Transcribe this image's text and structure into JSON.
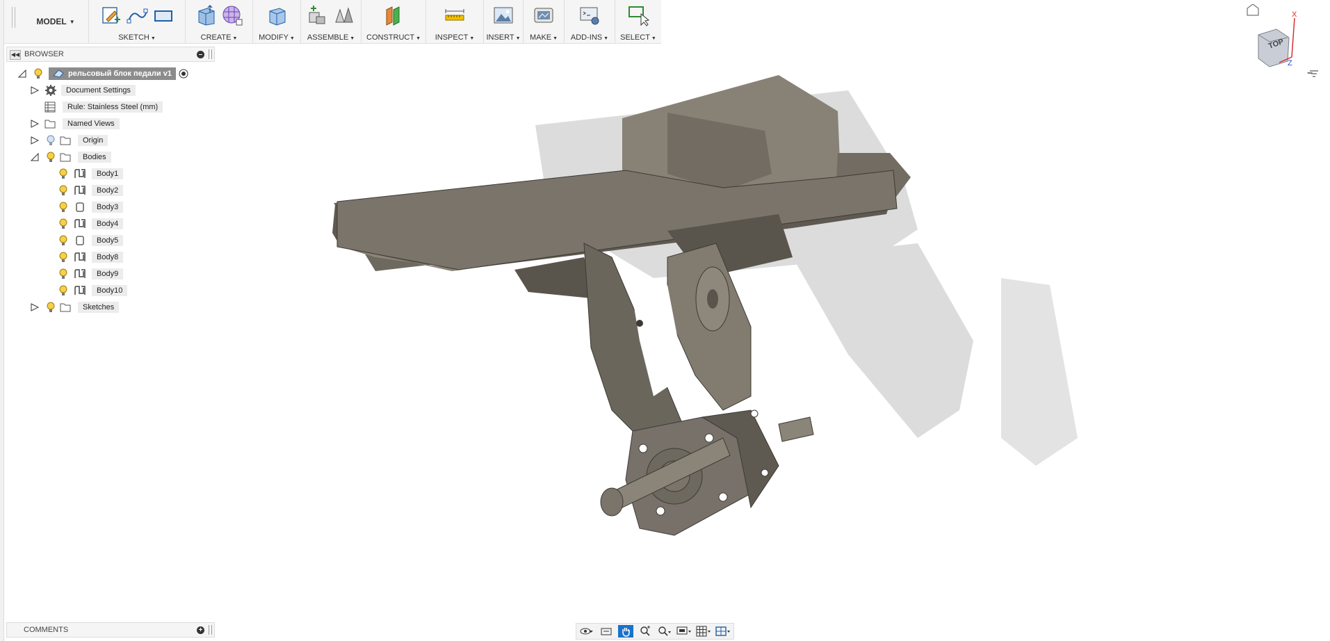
{
  "toolbar": {
    "workspace": "MODEL",
    "groups": [
      {
        "label": "SKETCH"
      },
      {
        "label": "CREATE"
      },
      {
        "label": "MODIFY"
      },
      {
        "label": "ASSEMBLE"
      },
      {
        "label": "CONSTRUCT"
      },
      {
        "label": "INSPECT"
      },
      {
        "label": "INSERT"
      },
      {
        "label": "MAKE"
      },
      {
        "label": "ADD-INS"
      },
      {
        "label": "SELECT"
      }
    ]
  },
  "browser": {
    "title": "BROWSER",
    "root": "рельсовый блок педали v1",
    "items": [
      {
        "label": "Document Settings"
      },
      {
        "label": "Rule: Stainless Steel (mm)"
      },
      {
        "label": "Named Views"
      },
      {
        "label": "Origin"
      },
      {
        "label": "Bodies"
      }
    ],
    "bodies": [
      "Body1",
      "Body2",
      "Body3",
      "Body4",
      "Body5",
      "Body8",
      "Body9",
      "Body10"
    ],
    "sketches": "Sketches"
  },
  "viewcube": {
    "face": "TOP",
    "axis_x": "X",
    "axis_z": "Z"
  },
  "comments": {
    "title": "COMMENTS"
  },
  "colors": {
    "accent": "#1a73c8",
    "model": "#7a746a",
    "panel": "#f5f5f5"
  }
}
